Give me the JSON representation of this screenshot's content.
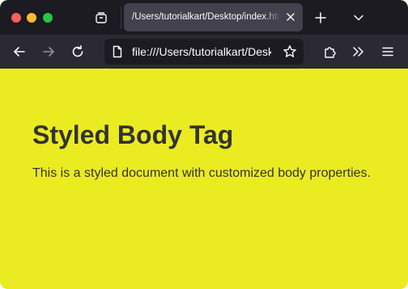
{
  "browser": {
    "window_controls": [
      "close",
      "minimize",
      "zoom"
    ],
    "tab": {
      "title": "/Users/tutorialkart/Desktop/index.html",
      "icons": [
        "tab-manager-icon",
        "close-icon",
        "plus-icon",
        "chevron-down-icon"
      ]
    },
    "toolbar": {
      "url": "file:///Users/tutorialkart/Desktop/index.html",
      "icons": [
        "back-arrow-icon",
        "forward-arrow-icon",
        "reload-icon",
        "page-icon",
        "star-icon",
        "extensions-icon",
        "overflow-chevrons-icon",
        "hamburger-menu-icon"
      ]
    },
    "colors": {
      "tabbar_bg": "#1c1b22",
      "toolbar_bg": "#2b2a33",
      "page_bg": "#ebeb22",
      "text": "#333333"
    }
  },
  "page": {
    "heading": "Styled Body Tag",
    "paragraph": "This is a styled document with customized body properties."
  }
}
